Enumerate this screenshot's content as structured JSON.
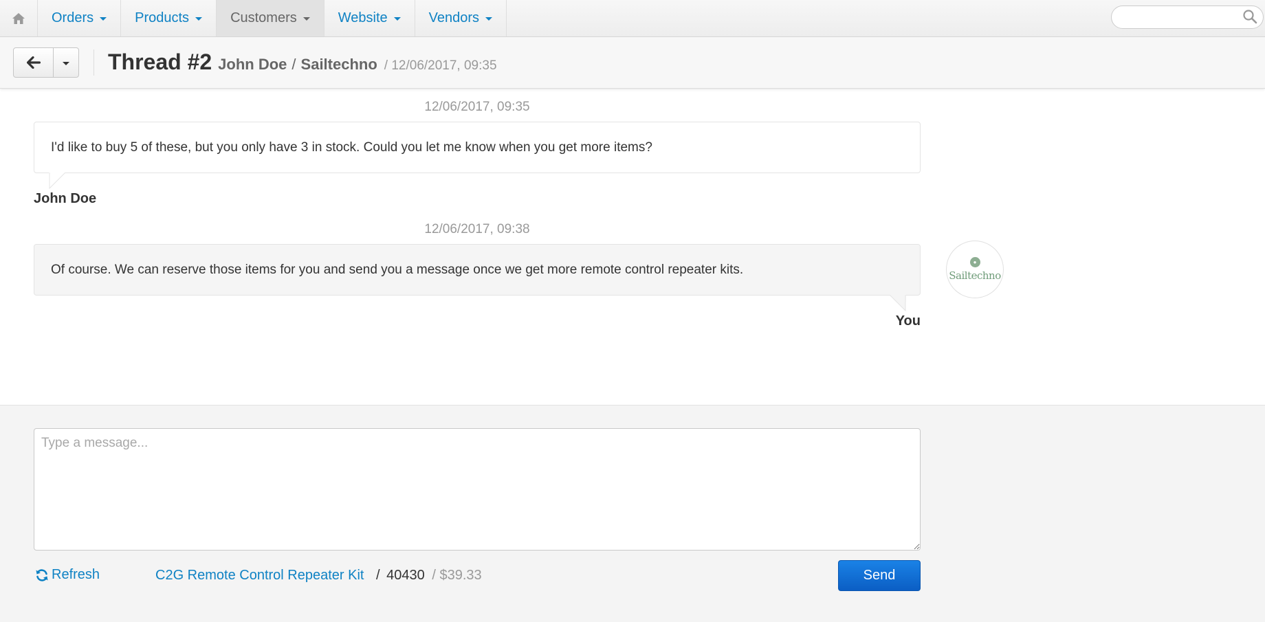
{
  "nav": {
    "home_icon": "home-icon",
    "items": [
      {
        "label": "Orders"
      },
      {
        "label": "Products"
      },
      {
        "label": "Customers",
        "active": true
      },
      {
        "label": "Website"
      },
      {
        "label": "Vendors"
      }
    ],
    "search": {
      "value": "",
      "placeholder": "",
      "icon": "search-icon"
    }
  },
  "header": {
    "back_icon": "arrow-left-icon",
    "dropdown_icon": "caret-down-icon",
    "title": "Thread #2",
    "customer": "John Doe",
    "separator": "/",
    "vendor": "Sailtechno",
    "date": "/ 12/06/2017, 09:35"
  },
  "messages": [
    {
      "timestamp": "12/06/2017, 09:35",
      "text": "I'd like to buy 5 of these, but you only have 3 in stock. Could you let me know when you get more items?",
      "author": "John Doe"
    },
    {
      "timestamp": "12/06/2017, 09:38",
      "text": "Of course. We can reserve those items for you and send you a message once we get more remote control repeater kits.",
      "author": "You",
      "avatar_text": "Sailtechno"
    }
  ],
  "reply": {
    "placeholder": "Type a message...",
    "value": "",
    "refresh_label": "Refresh",
    "refresh_icon": "refresh-icon",
    "send_label": "Send"
  },
  "product": {
    "name": "C2G Remote Control Repeater Kit",
    "separator": "/",
    "code": "40430",
    "price": "/ $39.33"
  },
  "colors": {
    "link": "#0f82c4",
    "send_button": "#0b5ec4",
    "muted": "#999999"
  }
}
